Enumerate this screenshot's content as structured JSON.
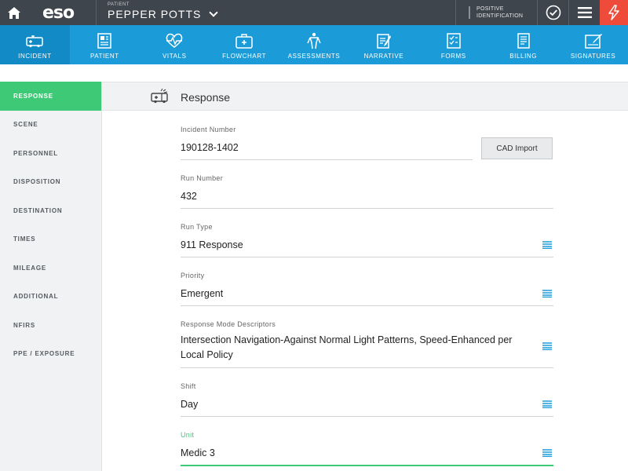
{
  "topbar": {
    "logo": "eso",
    "patient_label": "PATIENT",
    "patient_name": "PEPPER POTTS",
    "positive_id_line1": "POSITIVE",
    "positive_id_line2": "IDENTIFICATION"
  },
  "nav": {
    "tabs": [
      {
        "label": "INCIDENT",
        "icon": "ambulance-icon",
        "active": true
      },
      {
        "label": "PATIENT",
        "icon": "patient-chart-icon"
      },
      {
        "label": "VITALS",
        "icon": "heart-pulse-icon"
      },
      {
        "label": "FLOWCHART",
        "icon": "medkit-icon"
      },
      {
        "label": "ASSESSMENTS",
        "icon": "body-icon"
      },
      {
        "label": "NARRATIVE",
        "icon": "pencil-doc-icon"
      },
      {
        "label": "FORMS",
        "icon": "checklist-icon"
      },
      {
        "label": "BILLING",
        "icon": "invoice-icon"
      },
      {
        "label": "SIGNATURES",
        "icon": "signature-icon"
      }
    ]
  },
  "sidebar": {
    "items": [
      {
        "label": "RESPONSE",
        "active": true
      },
      {
        "label": "SCENE"
      },
      {
        "label": "PERSONNEL"
      },
      {
        "label": "DISPOSITION"
      },
      {
        "label": "DESTINATION"
      },
      {
        "label": "TIMES"
      },
      {
        "label": "MILEAGE"
      },
      {
        "label": "ADDITIONAL"
      },
      {
        "label": "NFIRS"
      },
      {
        "label": "PPE / EXPOSURE"
      }
    ]
  },
  "main": {
    "section_title": "Response",
    "cad_import": "CAD Import",
    "fields": {
      "incident_number": {
        "label": "Incident Number",
        "value": "190128-1402"
      },
      "run_number": {
        "label": "Run Number",
        "value": "432"
      },
      "run_type": {
        "label": "Run Type",
        "value": "911 Response"
      },
      "priority": {
        "label": "Priority",
        "value": "Emergent"
      },
      "response_mode": {
        "label": "Response Mode Descriptors",
        "value": "Intersection Navigation-Against Normal Light Patterns, Speed-Enhanced per Local Policy"
      },
      "shift": {
        "label": "Shift",
        "value": "Day"
      },
      "unit": {
        "label": "Unit",
        "value": "Medic 3"
      }
    }
  },
  "colors": {
    "topbar": "#3f454d",
    "nav": "#1b9bd8",
    "nav_active": "#118ac6",
    "accent_green": "#3ec977",
    "alert_red": "#ee4b3b",
    "list_icon": "#1b9bd8"
  }
}
